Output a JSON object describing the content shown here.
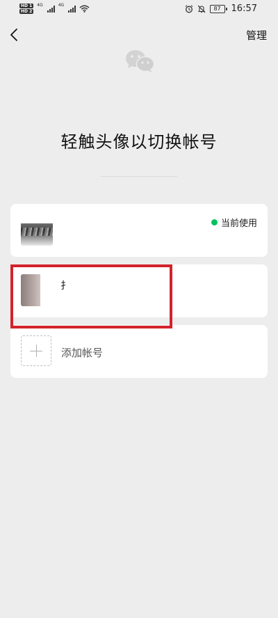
{
  "status_bar": {
    "hd1": "HD 1",
    "hd2": "HD 2",
    "net1": "4G",
    "net2": "4G",
    "battery": "87",
    "time": "16:57"
  },
  "nav": {
    "manage_label": "管理"
  },
  "page": {
    "title": "轻触头像以切换帐号"
  },
  "accounts": [
    {
      "name": "",
      "status": "当前使用",
      "status_color": "#07c160"
    },
    {
      "name": "扌"
    }
  ],
  "add_account": {
    "label": "添加帐号"
  },
  "colors": {
    "background": "#ededed",
    "card": "#ffffff",
    "active_green": "#07c160",
    "highlight_red": "#d3232b"
  },
  "icons": {
    "back": "chevron-left-icon",
    "logo": "wechat-logo-icon",
    "add": "plus-icon",
    "alarm": "alarm-icon",
    "mute": "bell-off-icon",
    "wifi": "wifi-icon"
  }
}
